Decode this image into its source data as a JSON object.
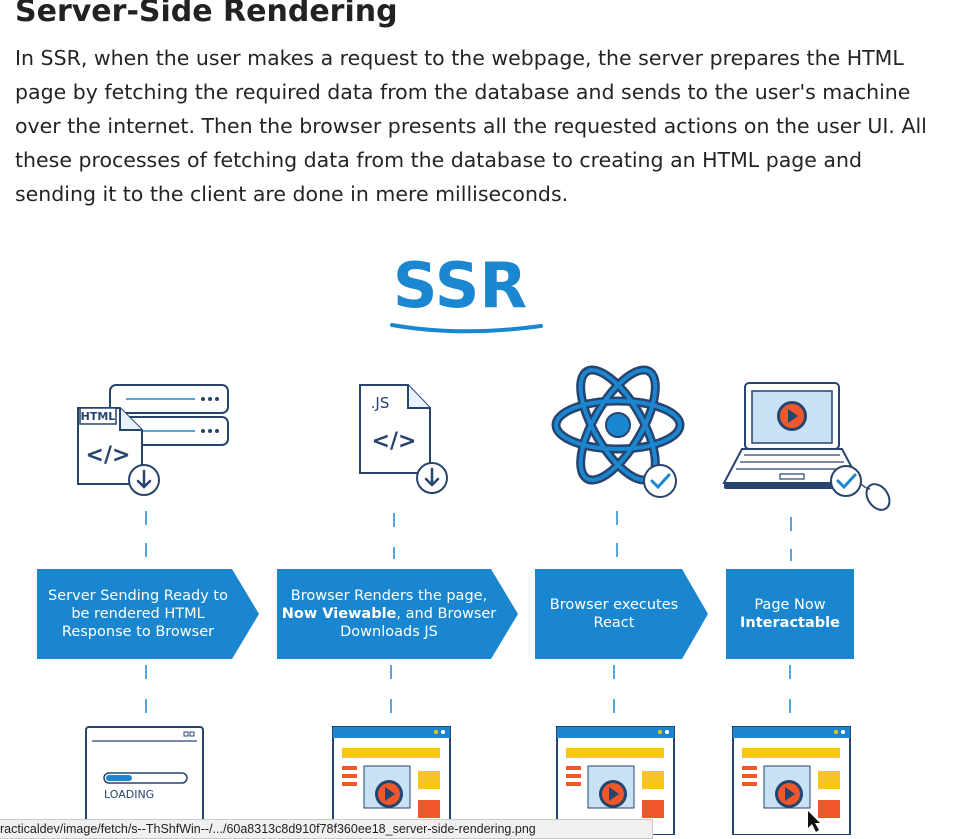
{
  "article": {
    "title": "Server-Side Rendering",
    "paragraph": "In SSR, when the user makes a request to the webpage, the server prepares the HTML page by fetching the required data from the database and sends to the user's machine over the internet. Then the browser presents all the requested actions on the user UI. All these processes of fetching data from the database to creating an HTML page and sending it to the client are done in mere milliseconds."
  },
  "figure": {
    "heading": "SSR",
    "html_tag": "HTML",
    "js_tag": ".JS",
    "code_glyph": "</>",
    "loading_label": "LOADING",
    "steps": [
      {
        "label": "Server Sending Ready to be rendered HTML Response to Browser"
      },
      {
        "label_before": "Browser Renders the page, ",
        "label_bold": "Now Viewable",
        "label_after": ", and Browser Downloads JS"
      },
      {
        "label": "Browser executes React"
      },
      {
        "label_top": "Page Now",
        "label_bold": "Interactable"
      }
    ],
    "colors": {
      "brand_blue": "#1b87d0",
      "step_blue": "#1a86cf",
      "ink": "#27446e",
      "yellow": "#f8c51e",
      "orange": "#f0572a",
      "light_blue": "#c7e2f5"
    }
  },
  "status_bar": {
    "url": "racticaldev/image/fetch/s--ThShfWin--/.../60a8313c8d910f78f360ee18_server-side-rendering.png"
  }
}
